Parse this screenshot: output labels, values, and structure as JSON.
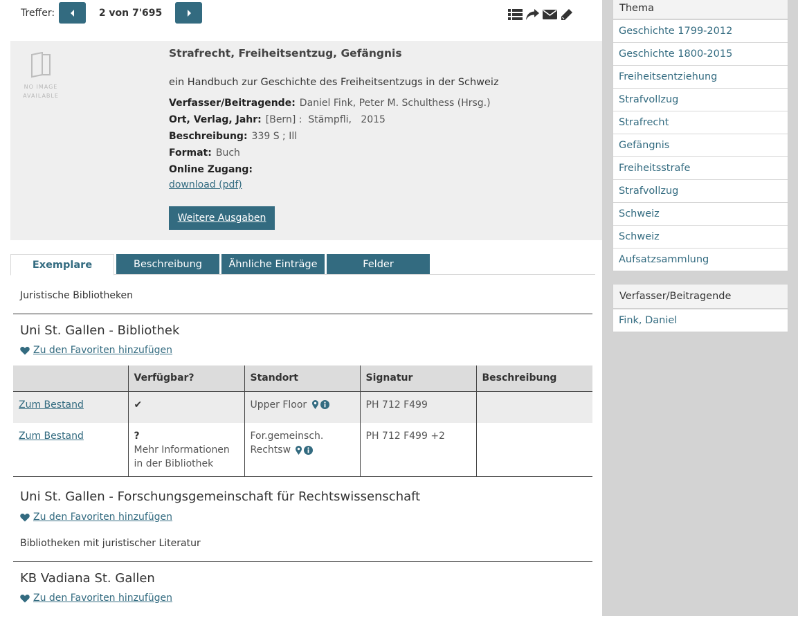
{
  "pager": {
    "label": "Treffer:",
    "count": "2 von 7'695"
  },
  "tools": [
    "list-icon",
    "share-icon",
    "envelope-icon",
    "pencil-icon"
  ],
  "record": {
    "noimage_text": "NO IMAGE AVAILABLE",
    "title": "Strafrecht, Freiheitsentzug, Gefängnis",
    "subtitle": "ein Handbuch zur Geschichte des Freiheitsentzugs in der Schweiz",
    "fields": {
      "authors_label": "Verfasser/Beitragende:",
      "authors_value": "Daniel Fink, Peter M. Schulthess (Hrsg.)",
      "pub_label": "Ort, Verlag, Jahr:",
      "pub_value": "[Bern] :  Stämpfli,   2015",
      "desc_label": "Beschreibung:",
      "desc_value": "339 S ; Ill",
      "format_label": "Format:",
      "format_value": "Buch",
      "online_label": "Online Zugang:",
      "online_link": "download (pdf)"
    },
    "more_button": "Weitere Ausgaben"
  },
  "tabs": {
    "exemplare": "Exemplare",
    "beschreibung": "Beschreibung",
    "aehnliche": "Ähnliche Einträge",
    "felder": "Felder"
  },
  "holdings": {
    "group1": "Juristische Bibliotheken",
    "lib1": {
      "name": "Uni St. Gallen - Bibliothek",
      "fav": "Zu den Favoriten hinzufügen"
    },
    "table": {
      "headers": [
        "",
        "Verfügbar?",
        "Standort",
        "Signatur",
        "Beschreibung"
      ],
      "rows": [
        {
          "link": "Zum Bestand",
          "avail_mark": "✔",
          "avail_text": "",
          "location": "Upper Floor",
          "signatur": "PH 712 F499",
          "beschreibung": ""
        },
        {
          "link": "Zum Bestand",
          "avail_mark": "?",
          "avail_text": "Mehr Informationen in der Bibliothek",
          "location": "For.gemeinsch. Rechtsw",
          "signatur": "PH 712 F499 +2",
          "beschreibung": ""
        }
      ]
    },
    "lib2": {
      "name": "Uni St. Gallen - Forschungsgemeinschaft für Rechtswissenschaft",
      "fav": "Zu den Favoriten hinzufügen"
    },
    "group2": "Bibliotheken mit juristischer Literatur",
    "lib3": {
      "name": "KB Vadiana St. Gallen",
      "fav": "Zu den Favoriten hinzufügen"
    }
  },
  "sidebar": {
    "thema": {
      "title": "Thema",
      "items": [
        "Geschichte 1799-2012",
        "Geschichte 1800-2015",
        "Freiheitsentziehung",
        "Strafvollzug",
        "Strafrecht",
        "Gefängnis",
        "Freiheitsstrafe",
        "Strafvollzug",
        "Schweiz",
        "Schweiz",
        "Aufsatzsammlung"
      ]
    },
    "authors": {
      "title": "Verfasser/Beitragende",
      "items": [
        "Fink, Daniel"
      ]
    }
  },
  "colors": {
    "accent": "#336b80",
    "record_bg": "#efefef",
    "sidebar_bg": "#d3d3d3",
    "table_header_bg": "#dcdcdc"
  }
}
